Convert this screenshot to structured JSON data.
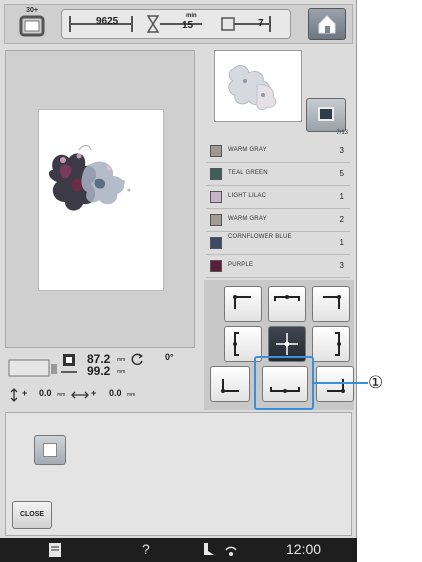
{
  "top_bar": {
    "hoop_label": "30+",
    "stitch_count": "9625",
    "time_value": "15",
    "time_unit": "min",
    "color_step": "7"
  },
  "color_list": {
    "header": "7/13",
    "items": [
      {
        "name": "WARM GRAY",
        "step": "3",
        "color": "#9e9a92"
      },
      {
        "name": "TEAL GREEN",
        "step": "5",
        "color": "#3f5f58"
      },
      {
        "name": "LIGHT LILAC",
        "step": "1",
        "color": "#c3b4c8"
      },
      {
        "name": "WARM GRAY",
        "step": "2",
        "color": "#a19d95"
      },
      {
        "name": "CORNFLOWER BLUE",
        "step": "1",
        "color": "#3c4a66"
      },
      {
        "name": "PURPLE",
        "step": "3",
        "color": "#5b1f3a"
      }
    ]
  },
  "info": {
    "width_value": "87.2",
    "width_unit": "mm",
    "height_value": "99.2",
    "height_unit": "mm",
    "angle": "0°",
    "offset_x": "0.0",
    "offset_x_unit": "mm",
    "offset_y": "0.0",
    "offset_y_unit": "mm"
  },
  "panel": {
    "close_label": "CLOSE"
  },
  "callout": {
    "number": "①",
    "color": "#3b8fd8"
  },
  "status_bar": {
    "help": "?",
    "clock": "12:00"
  }
}
